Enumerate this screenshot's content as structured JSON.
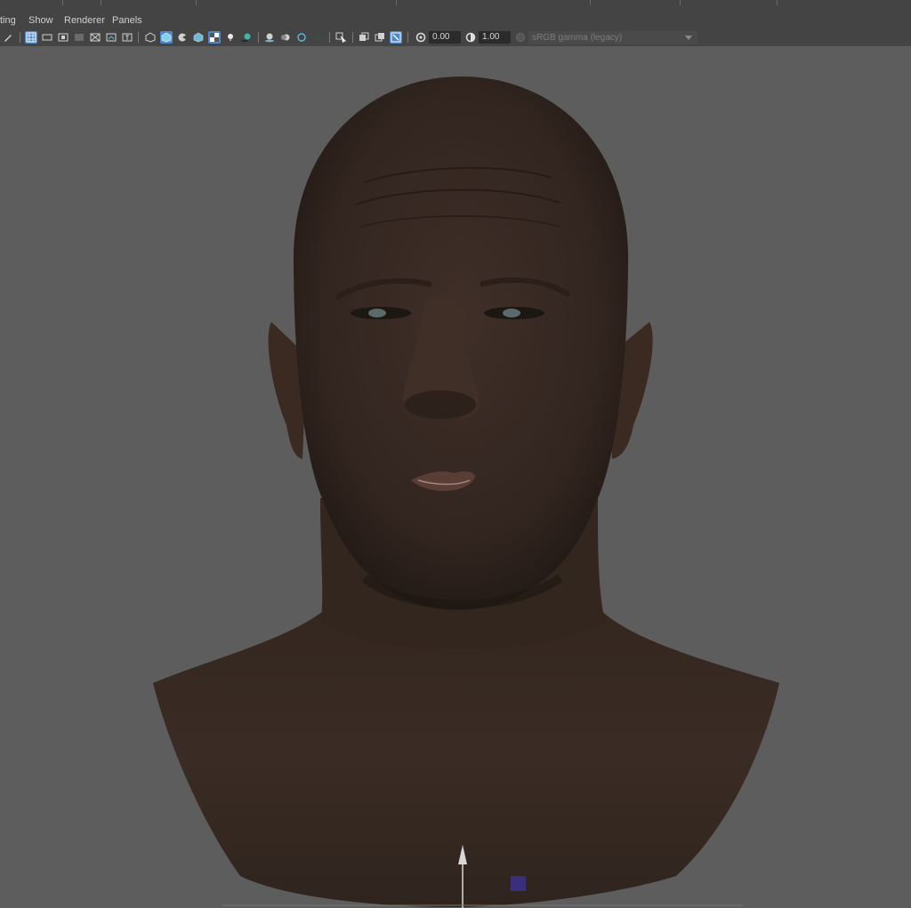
{
  "menu": {
    "items": [
      "ting",
      "Show",
      "Renderer",
      "Panels"
    ]
  },
  "toolbar": {
    "exposure_value": "0.00",
    "gamma_value": "1.00",
    "color_space": "sRGB gamma (legacy)"
  },
  "viewport": {
    "object": "head-mesh",
    "background_color": "#5d5d5d",
    "skin_color": "#3b2c25"
  },
  "colors": {
    "accent": "#4f88c9",
    "panel": "#444444",
    "manipulator": "#3a2f7a"
  }
}
